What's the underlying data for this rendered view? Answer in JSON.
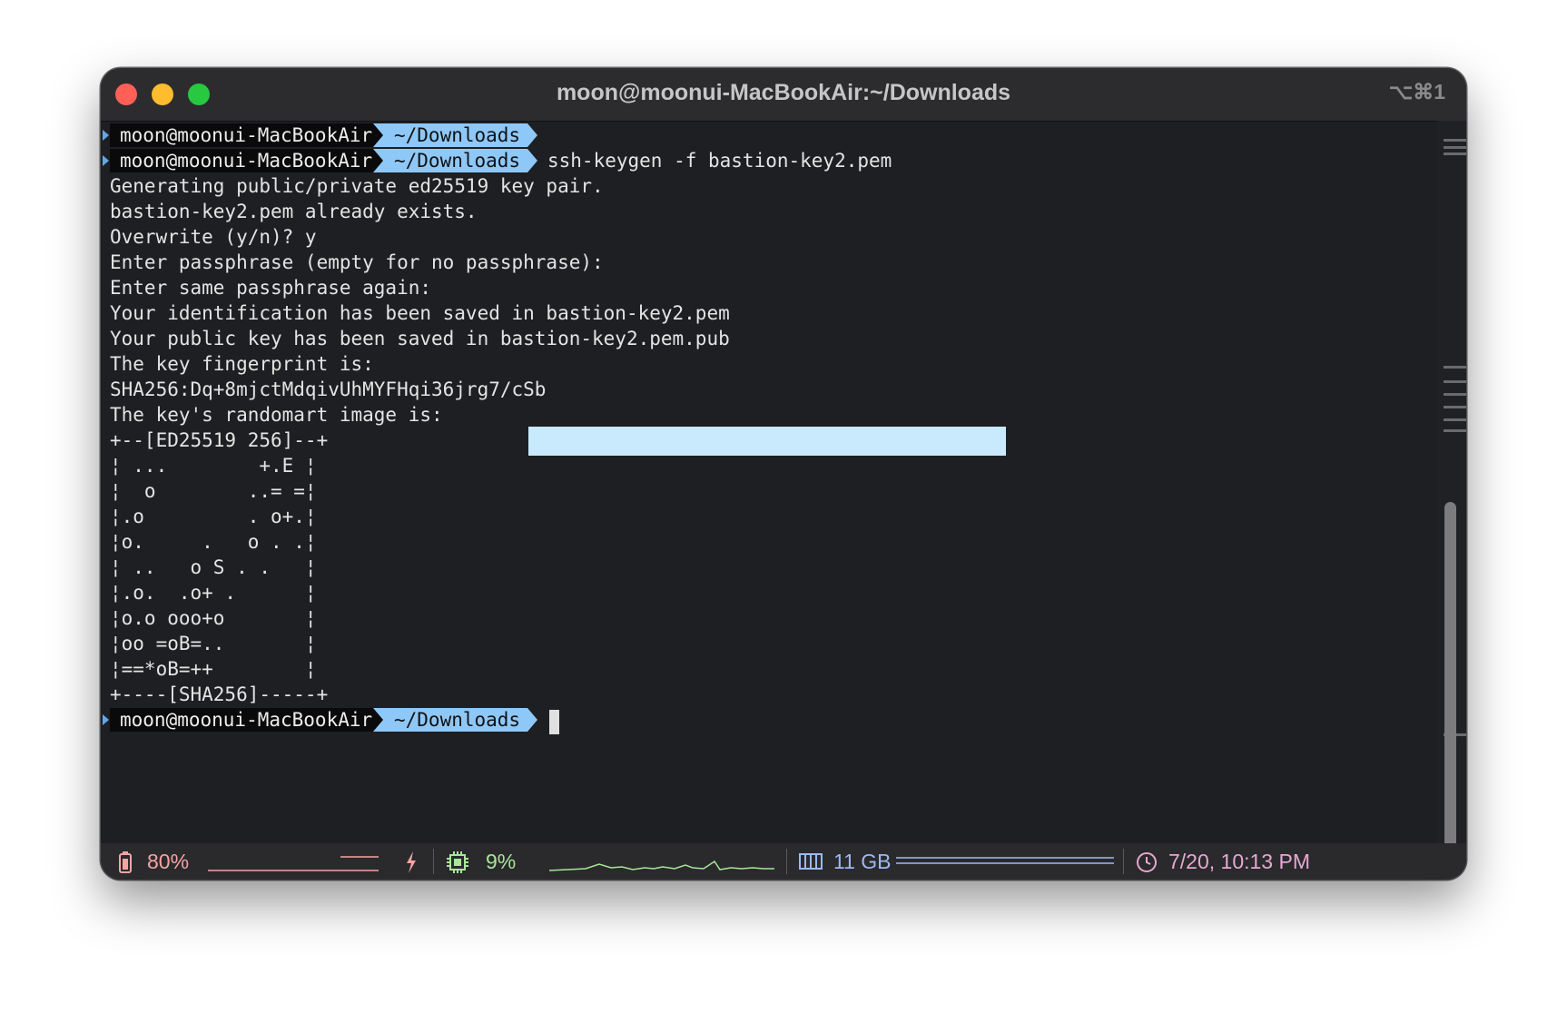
{
  "window": {
    "title": "moon@moonui-MacBookAir:~/Downloads",
    "shortcut": "⌥⌘1"
  },
  "prompt": {
    "user": "moon@moonui-MacBookAir",
    "dir": "~/Downloads",
    "command": "ssh-keygen -f bastion-key2.pem"
  },
  "output": [
    "Generating public/private ed25519 key pair.",
    "bastion-key2.pem already exists.",
    "Overwrite (y/n)? y",
    "Enter passphrase (empty for no passphrase):",
    "Enter same passphrase again:",
    "Your identification has been saved in bastion-key2.pem",
    "Your public key has been saved in bastion-key2.pem.pub",
    "The key fingerprint is:",
    "SHA256:Dq+8mjctMdqivUhMYFHqi36jrg7/cSb",
    "The key's randomart image is:",
    "+--[ED25519 256]--+",
    "¦ ...        +.E ¦",
    "¦  o        ..= =¦",
    "¦.o         . o+.¦",
    "¦o.     .   o . .¦",
    "¦ ..   o S . .   ¦",
    "¦.o.  .o+ .      ¦",
    "¦o.o ooo+o       ¦",
    "¦oo =oB=..       ¦",
    "¦==*oB=++        ¦",
    "+----[SHA256]-----+"
  ],
  "status": {
    "battery": "80%",
    "cpu": "9%",
    "memory": "11 GB",
    "clock": "7/20, 10:13 PM",
    "colors": {
      "battery": "#f3a5a4",
      "cpu": "#a8e69a",
      "memory": "#9cb8f4",
      "clock": "#e6a7d2"
    }
  },
  "icons": [
    "battery-icon",
    "bolt-icon",
    "cpu-chip-icon",
    "memory-icon",
    "clock-icon"
  ]
}
